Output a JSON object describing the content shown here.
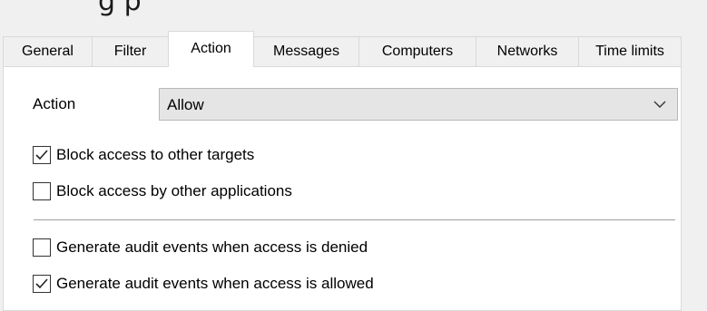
{
  "window": {
    "heading_partial": "g p"
  },
  "tabs": [
    {
      "label": "General",
      "active": false
    },
    {
      "label": "Filter",
      "active": false
    },
    {
      "label": "Action",
      "active": true
    },
    {
      "label": "Messages",
      "active": false
    },
    {
      "label": "Computers",
      "active": false
    },
    {
      "label": "Networks",
      "active": false
    },
    {
      "label": "Time limits",
      "active": false
    }
  ],
  "action": {
    "label": "Action",
    "selected": "Allow"
  },
  "options": [
    {
      "label": "Block access to other targets",
      "checked": true
    },
    {
      "label": "Block access by other applications",
      "checked": false
    },
    {
      "label": "Generate audit events when access is denied",
      "checked": false
    },
    {
      "label": "Generate audit events when access is allowed",
      "checked": true
    }
  ],
  "icons": {
    "dropdown": "chevron-down-icon",
    "check": "checkmark-icon"
  },
  "colors": {
    "panel": "#ffffff",
    "window": "#f0f0f0",
    "select": "#e5e5e5",
    "border": "#d9d9d9"
  }
}
